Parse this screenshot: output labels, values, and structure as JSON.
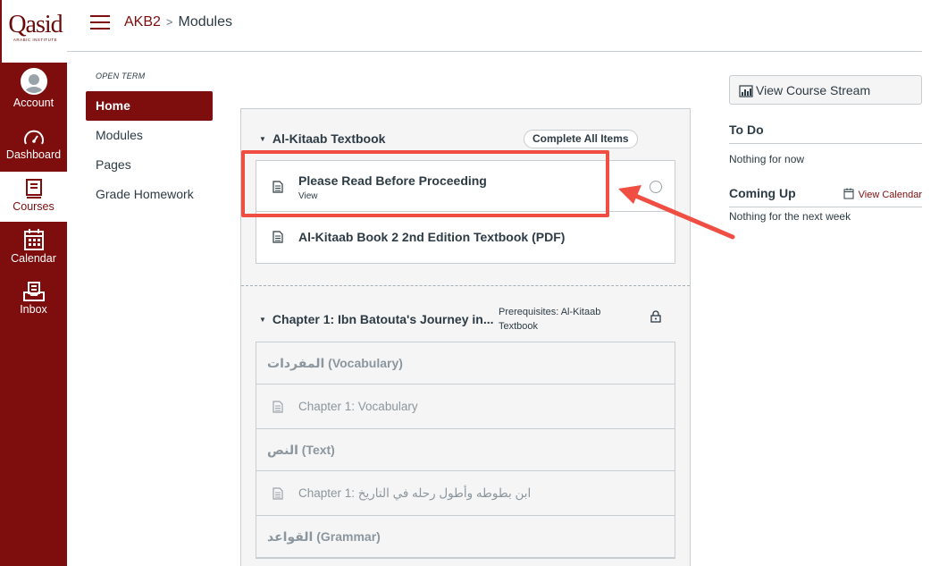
{
  "brand": {
    "logo_text": "Qasid",
    "logo_sub": "ARABIC INSTITUTE"
  },
  "global_nav": [
    {
      "label": "Account",
      "icon": "account-avatar"
    },
    {
      "label": "Dashboard",
      "icon": "dashboard-icon"
    },
    {
      "label": "Courses",
      "icon": "courses-icon"
    },
    {
      "label": "Calendar",
      "icon": "calendar-icon"
    },
    {
      "label": "Inbox",
      "icon": "inbox-icon"
    }
  ],
  "breadcrumb": {
    "course": "AKB2",
    "separator": ">",
    "current": "Modules"
  },
  "course_nav": {
    "term": "OPEN TERM",
    "items": [
      "Home",
      "Modules",
      "Pages",
      "Grade Homework"
    ]
  },
  "module1": {
    "title": "Al-Kitaab Textbook",
    "complete_all": "Complete All Items",
    "items": [
      {
        "title": "Please Read Before Proceeding",
        "sub": "View"
      },
      {
        "title": "Al-Kitaab Book 2 2nd Edition Textbook (PDF)"
      }
    ]
  },
  "module2": {
    "title": "Chapter 1: Ibn Batouta's Journey in...",
    "prereq": "Prerequisites: Al-Kitaab Textbook",
    "rows": [
      {
        "kind": "header",
        "text": "المفردات (Vocabulary)"
      },
      {
        "kind": "item",
        "text": "Chapter 1: Vocabulary"
      },
      {
        "kind": "header",
        "text": "النص (Text)"
      },
      {
        "kind": "item",
        "text": "Chapter 1: ابن بطوطه وأطول رحله في التاريخ"
      },
      {
        "kind": "header",
        "text": "القواعد (Grammar)"
      }
    ]
  },
  "sidebar": {
    "stream_button": "View Course Stream",
    "todo_title": "To Do",
    "todo_empty": "Nothing for now",
    "coming_title": "Coming Up",
    "view_calendar": "View Calendar",
    "coming_empty": "Nothing for the next week"
  },
  "colors": {
    "brand": "#7e0d0d",
    "highlight": "#f04e43",
    "text": "#2d3b45",
    "muted": "#8b969e"
  }
}
